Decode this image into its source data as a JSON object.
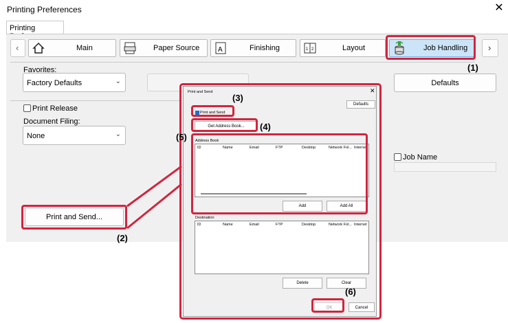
{
  "window": {
    "title": "Printing Preferences",
    "tab": "Printing Preferences"
  },
  "nav": {
    "prev": "‹",
    "next": "›",
    "tabs": [
      {
        "label": "Main",
        "icon": "house-icon"
      },
      {
        "label": "Paper Source",
        "icon": "printer-tray-icon"
      },
      {
        "label": "Finishing",
        "icon": "finishing-document-icon"
      },
      {
        "label": "Layout",
        "icon": "layout-pages-icon"
      },
      {
        "label": "Job Handling",
        "icon": "job-handling-stack-icon"
      }
    ]
  },
  "favorites": {
    "label": "Favorites:",
    "value": "Factory Defaults",
    "defaults_button": "Defaults"
  },
  "print_release": {
    "label": "Print Release",
    "checked": false
  },
  "document_filing": {
    "label": "Document Filing:",
    "value": "None"
  },
  "job_name": {
    "label": "Job Name",
    "checked": false,
    "value": ""
  },
  "print_and_send_button": "Print and Send...",
  "annotations": {
    "a1": "(1)",
    "a2": "(2)",
    "a3": "(3)",
    "a4": "(4)",
    "a5": "(5)",
    "a6": "(6)"
  },
  "dialog": {
    "title": "Print and Send",
    "defaults_button": "Defaults",
    "checkbox_label": "Print and Send",
    "get_address_book_button": "Get Address Book...",
    "address_book_label": "Address Book",
    "columns": [
      "ID",
      "Name",
      "Email",
      "FTP",
      "Desktop",
      "Network Fol...",
      "Internet"
    ],
    "add_button": "Add",
    "add_all_button": "Add All",
    "destination_label": "Destination",
    "delete_button": "Delete",
    "clear_button": "Clear",
    "ok_button": "OK",
    "cancel_button": "Cancel"
  },
  "colors": {
    "highlight": "#d0253f",
    "selected_tab": "#cce4f7"
  }
}
